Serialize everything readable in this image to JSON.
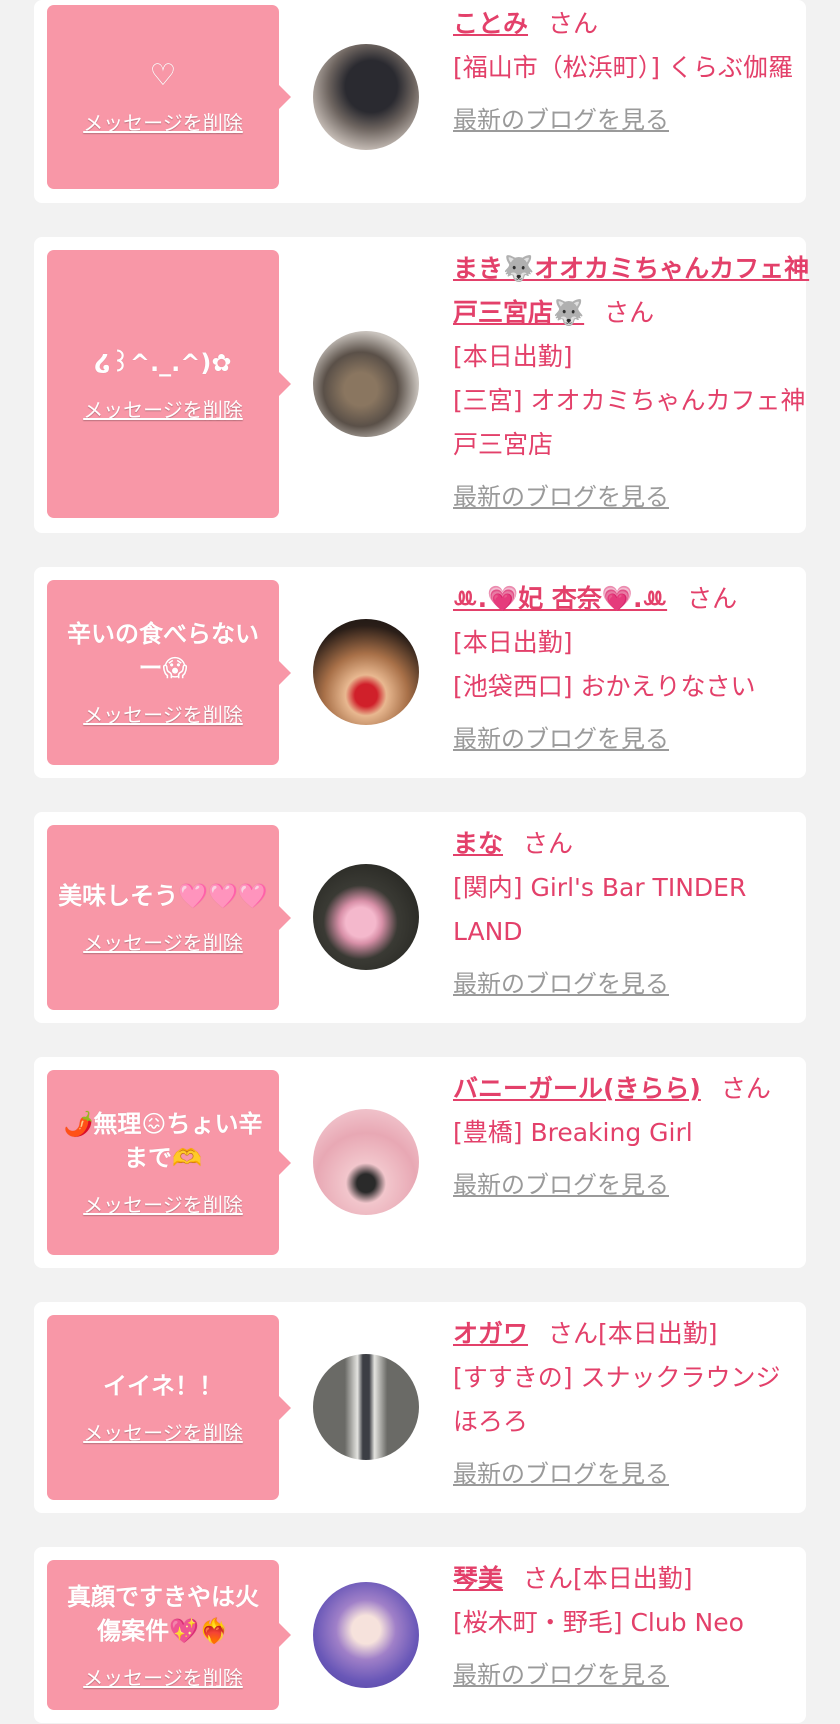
{
  "colors": {
    "accent": "#e3406a",
    "bubble": "#f897a7",
    "muted": "#9a9a9a",
    "background": "#f2f2f2"
  },
  "delete_label": "メッセージを削除",
  "blog_label": "最新のブログを見る",
  "entries": [
    {
      "message": "♡",
      "name": "ことみ",
      "honorific": "さん",
      "status": "",
      "area": "[福山市（松浜町）]",
      "shop": "くらぶ伽羅"
    },
    {
      "message": "໒꒱^._.^)✿",
      "name": "まき🐺オオカミちゃんカフェ神戸三宮店🐺",
      "honorific": "さん",
      "status": "[本日出勤]",
      "area": "[三宮]",
      "shop": "オオカミちゃんカフェ神戸三宮店"
    },
    {
      "message": "辛いの食べらないー😱",
      "name": "ꔛ.💗妃 杏奈💗.ꔛ",
      "honorific": "さん",
      "status": "[本日出勤]",
      "area": "[池袋西口]",
      "shop": "おかえりなさい"
    },
    {
      "message": "美味しそう🩷🩷🩷",
      "name": "まな",
      "honorific": "さん",
      "status": "",
      "area": "[関内]",
      "shop": "Girl's Bar TINDER LAND"
    },
    {
      "message": "🌶️無理😖ちょい辛まで🫶",
      "name": "バニーガール(きらら)",
      "honorific": "さん",
      "status": "",
      "area": "[豊橋]",
      "shop": "Breaking Girl"
    },
    {
      "message": "イイネ！！",
      "name": "オガワ",
      "honorific": "さん",
      "status": "[本日出勤]",
      "area": "[すすきの]",
      "shop": "スナックラウンジ　ほろろ"
    },
    {
      "message": "真顔ですきやは火傷案件💖❤️‍🔥",
      "name": "琴美",
      "honorific": "さん",
      "status": "[本日出勤]",
      "area": "[桜木町・野毛]",
      "shop": "Club Neo"
    }
  ]
}
